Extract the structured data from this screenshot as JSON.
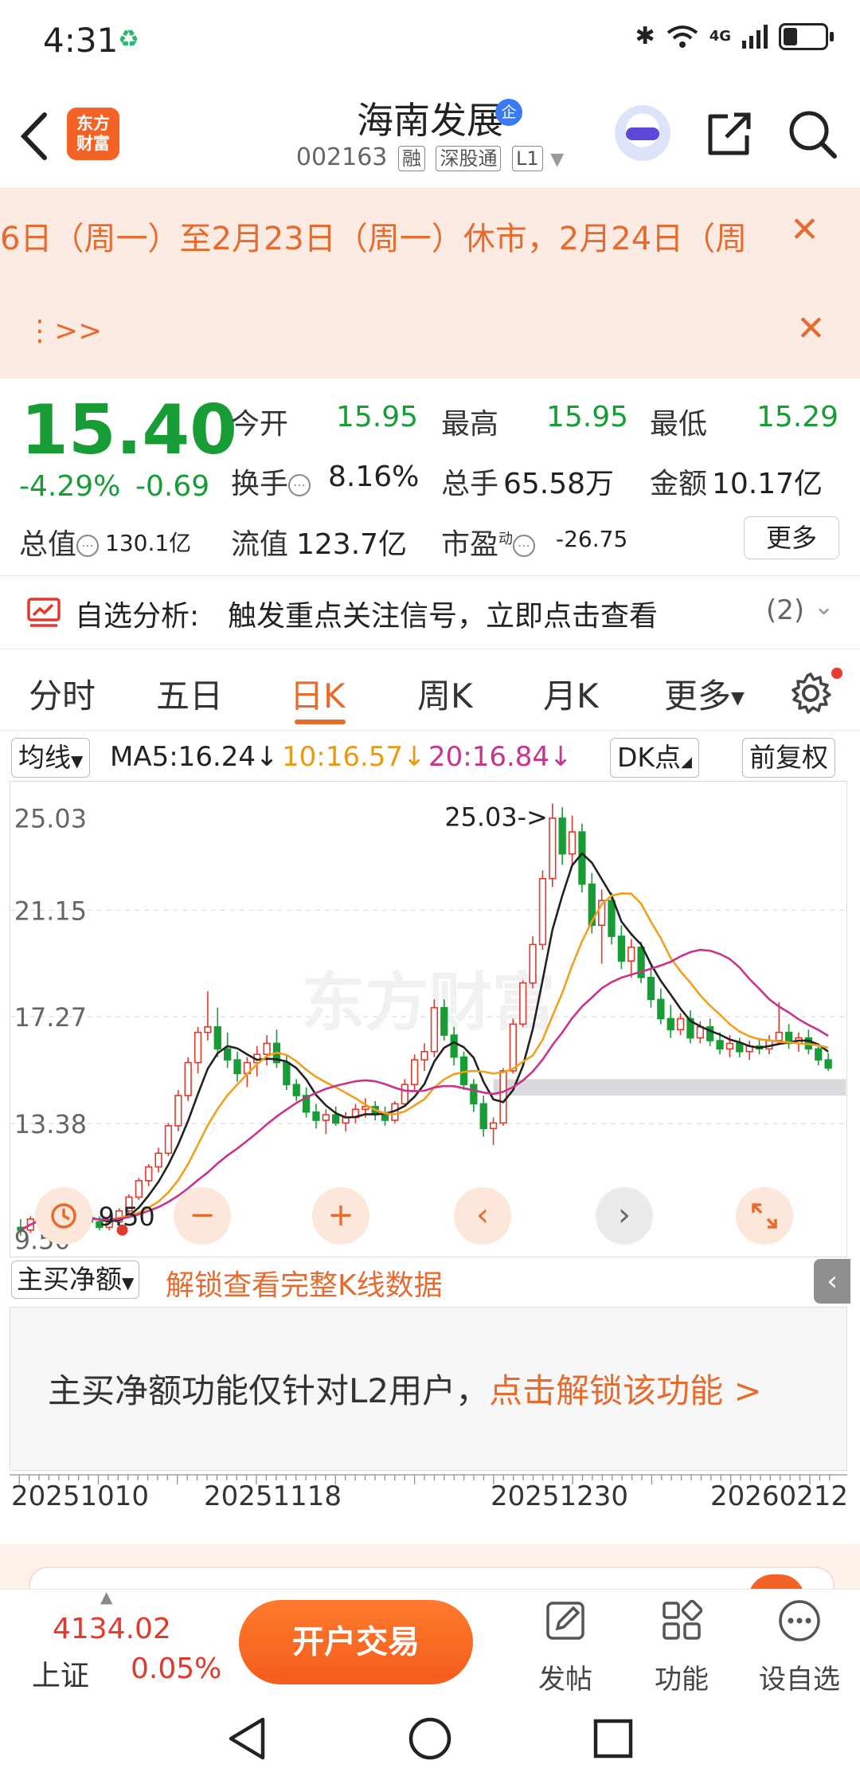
{
  "status_bar": {
    "time": "4:31",
    "signal_label": "4G",
    "icons": [
      "sync-icon",
      "bluetooth-icon",
      "wifi-icon",
      "signal-icon",
      "battery-icon"
    ]
  },
  "header": {
    "stock_name": "海南发展",
    "corp_badge": "企",
    "code": "002163",
    "tags": [
      "融",
      "深股通",
      "L1"
    ],
    "logo_line1": "东方",
    "logo_line2": "财富"
  },
  "notice": {
    "text": "6日（周一）至2月23日（周一）休市，2月24日（周",
    "more": "⋮>>"
  },
  "quote": {
    "price": "15.40",
    "change_pct": "-4.29%",
    "change_amt": "-0.69",
    "open_label": "今开",
    "open": "15.95",
    "high_label": "最高",
    "high": "15.95",
    "low_label": "最低",
    "low": "15.29",
    "turnover_label": "换手",
    "turnover": "8.16%",
    "volume_label": "总手",
    "volume": "65.58万",
    "amount_label": "金额",
    "amount": "10.17亿",
    "mktcap_label": "总值",
    "mktcap": "130.1亿",
    "float_label": "流值",
    "float_cap": "123.7亿",
    "pe_label": "市盈",
    "pe_sup": "动",
    "pe": "-26.75",
    "more_button": "更多"
  },
  "analysis": {
    "label": "自选分析:",
    "text": "触发重点关注信号，立即点击查看",
    "count": "(2)"
  },
  "tabs": [
    "分时",
    "五日",
    "日K",
    "周K",
    "月K",
    "更多"
  ],
  "active_tab": "日K",
  "indicators": {
    "ma_select": "均线",
    "ma5": "MA5:16.24↓",
    "ma10": "10:16.57↓",
    "ma20": "20:16.84↓",
    "dk_point": "DK点",
    "adjust": "前复权",
    "colors": {
      "ma5": "#222222",
      "ma10": "#f0a020",
      "ma20": "#c8338c"
    }
  },
  "chart_data": {
    "type": "candlestick",
    "y_labels": [
      "25.03",
      "21.15",
      "17.27",
      "13.38",
      "9.50"
    ],
    "ylim": [
      9.0,
      25.6
    ],
    "max_marker": "25.03->",
    "min_marker": "9.50",
    "watermark": "东方财富",
    "x_labels": [
      "20251010",
      "20251118",
      "20251230",
      "20260212"
    ],
    "up_color": "#e03a2d",
    "down_color": "#179c36",
    "zone": [
      14.4,
      15.0
    ],
    "ohlc": [
      [
        9.6,
        9.9,
        9.3,
        9.5
      ],
      [
        9.5,
        10.0,
        9.4,
        9.9
      ],
      [
        9.9,
        10.4,
        9.8,
        10.2
      ],
      [
        10.2,
        10.5,
        9.9,
        10.0
      ],
      [
        10.0,
        10.3,
        9.8,
        10.1
      ],
      [
        10.1,
        10.4,
        9.9,
        10.0
      ],
      [
        10.0,
        10.2,
        9.7,
        9.9
      ],
      [
        9.9,
        10.1,
        9.6,
        9.8
      ],
      [
        9.8,
        10.0,
        9.5,
        9.6
      ],
      [
        9.6,
        9.9,
        9.5,
        9.8
      ],
      [
        9.8,
        10.3,
        9.7,
        10.2
      ],
      [
        10.2,
        10.8,
        10.1,
        10.7
      ],
      [
        10.7,
        11.4,
        10.6,
        11.3
      ],
      [
        11.3,
        11.9,
        11.1,
        11.8
      ],
      [
        11.8,
        12.5,
        11.6,
        12.3
      ],
      [
        12.3,
        13.4,
        12.2,
        13.3
      ],
      [
        13.3,
        14.6,
        13.1,
        14.4
      ],
      [
        14.4,
        15.8,
        14.2,
        15.6
      ],
      [
        15.6,
        16.9,
        15.2,
        16.7
      ],
      [
        16.7,
        18.2,
        16.4,
        16.9
      ],
      [
        16.9,
        17.6,
        15.8,
        16.1
      ],
      [
        16.1,
        16.7,
        15.4,
        15.7
      ],
      [
        15.7,
        16.0,
        14.9,
        15.2
      ],
      [
        15.2,
        15.8,
        14.7,
        15.6
      ],
      [
        15.6,
        16.2,
        15.1,
        15.9
      ],
      [
        15.9,
        16.6,
        15.5,
        16.3
      ],
      [
        16.3,
        16.8,
        15.4,
        15.6
      ],
      [
        15.6,
        15.9,
        14.6,
        14.8
      ],
      [
        14.8,
        15.0,
        14.2,
        14.4
      ],
      [
        14.4,
        14.7,
        13.6,
        13.8
      ],
      [
        13.8,
        14.1,
        13.2,
        13.5
      ],
      [
        13.5,
        13.9,
        13.0,
        13.7
      ],
      [
        13.7,
        14.0,
        13.3,
        13.4
      ],
      [
        13.4,
        13.8,
        13.1,
        13.6
      ],
      [
        13.6,
        14.1,
        13.4,
        13.9
      ],
      [
        13.9,
        14.3,
        13.6,
        14.0
      ],
      [
        14.0,
        14.2,
        13.5,
        13.7
      ],
      [
        13.7,
        14.0,
        13.3,
        13.5
      ],
      [
        13.5,
        14.2,
        13.4,
        14.1
      ],
      [
        14.1,
        15.0,
        14.0,
        14.8
      ],
      [
        14.8,
        15.9,
        14.6,
        15.7
      ],
      [
        15.7,
        16.3,
        15.3,
        16.0
      ],
      [
        16.0,
        17.9,
        15.8,
        17.6
      ],
      [
        17.6,
        17.9,
        16.4,
        16.6
      ],
      [
        16.6,
        16.9,
        15.5,
        15.8
      ],
      [
        15.8,
        16.0,
        14.6,
        14.8
      ],
      [
        14.8,
        15.0,
        13.8,
        14.1
      ],
      [
        14.1,
        14.4,
        12.9,
        13.2
      ],
      [
        13.2,
        13.6,
        12.6,
        13.4
      ],
      [
        13.4,
        15.4,
        13.3,
        15.3
      ],
      [
        15.3,
        17.2,
        15.2,
        17.0
      ],
      [
        17.0,
        18.6,
        16.9,
        18.5
      ],
      [
        18.5,
        20.2,
        18.3,
        19.9
      ],
      [
        19.9,
        22.6,
        19.7,
        22.3
      ],
      [
        22.3,
        25.03,
        22.0,
        24.5
      ],
      [
        24.5,
        24.9,
        22.8,
        23.2
      ],
      [
        23.2,
        24.6,
        22.8,
        24.0
      ],
      [
        24.0,
        24.3,
        21.8,
        22.1
      ],
      [
        22.1,
        22.5,
        20.3,
        20.6
      ],
      [
        20.6,
        21.9,
        19.2,
        21.5
      ],
      [
        21.5,
        21.8,
        19.9,
        20.2
      ],
      [
        20.2,
        20.6,
        19.0,
        19.3
      ],
      [
        19.3,
        20.1,
        18.7,
        19.8
      ],
      [
        19.8,
        20.0,
        18.5,
        18.7
      ],
      [
        18.7,
        19.1,
        17.6,
        17.9
      ],
      [
        17.9,
        18.3,
        17.0,
        17.2
      ],
      [
        17.2,
        17.7,
        16.5,
        16.8
      ],
      [
        16.8,
        17.4,
        16.6,
        17.2
      ],
      [
        17.2,
        17.5,
        16.3,
        16.5
      ],
      [
        16.5,
        17.1,
        16.3,
        16.9
      ],
      [
        16.9,
        17.2,
        16.2,
        16.4
      ],
      [
        16.4,
        16.7,
        15.9,
        16.1
      ],
      [
        16.1,
        16.6,
        15.8,
        16.3
      ],
      [
        16.3,
        16.5,
        15.8,
        16.0
      ],
      [
        16.0,
        16.4,
        15.7,
        16.2
      ],
      [
        16.2,
        16.5,
        15.9,
        16.1
      ],
      [
        16.1,
        16.6,
        15.9,
        16.4
      ],
      [
        16.4,
        17.8,
        16.3,
        16.7
      ],
      [
        16.7,
        17.0,
        16.1,
        16.3
      ],
      [
        16.3,
        16.7,
        16.0,
        16.5
      ],
      [
        16.5,
        16.8,
        15.9,
        16.1
      ],
      [
        16.1,
        16.3,
        15.5,
        15.7
      ],
      [
        15.7,
        15.95,
        15.29,
        15.4
      ]
    ]
  },
  "chart_controls": [
    "−",
    "+",
    "‹",
    "›"
  ],
  "sub_chart": {
    "select": "主买净额",
    "unlock_link": "解锁查看完整K线数据",
    "message": "主买净额功能仅针对L2用户，",
    "cta": "点击解锁该功能 >"
  },
  "bottom_bar": {
    "index_value": "4134.02",
    "index_name": "上证",
    "index_pct": "0.05%",
    "trade_button": "开户交易",
    "post": "发帖",
    "functions": "功能",
    "add_watch": "设自选"
  }
}
